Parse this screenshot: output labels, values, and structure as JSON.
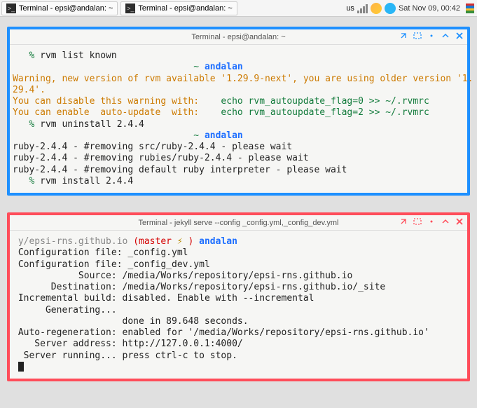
{
  "panel": {
    "task1": "Terminal - epsi@andalan: ~",
    "task2": "Terminal - epsi@andalan: ~",
    "kbd": "us",
    "clock": "Sat Nov 09, 00:42"
  },
  "win1": {
    "title": "Terminal - epsi@andalan: ~",
    "line1a": "% ",
    "line1b": "rvm list known",
    "ctx1a": "~ ",
    "ctx1b": "andalan",
    "warn1": "Warning, new version of rvm available '1.29.9-next', you are using older version '1.",
    "warn2": "29.4'.",
    "warn3a": "You can disable this warning with:    ",
    "warn3b": "echo rvm_autoupdate_flag=0 >> ~/.rvmrc",
    "warn4a": "You can enable  auto-update  with:    ",
    "warn4b": "echo rvm_autoupdate_flag=2 >> ~/.rvmrc",
    "line2a": "% ",
    "line2b": "rvm uninstall 2.4.4",
    "rem1": "ruby-2.4.4 - #removing src/ruby-2.4.4 - please wait",
    "rem2": "ruby-2.4.4 - #removing rubies/ruby-2.4.4 - please wait",
    "rem3": "ruby-2.4.4 - #removing default ruby interpreter - please wait",
    "line3a": "% ",
    "line3b": "rvm install 2.4.4"
  },
  "win2": {
    "title": "Terminal - jekyll serve --config _config.yml,_config_dev.yml",
    "path": "y/epsi-rns.github.io ",
    "branch": "(master ",
    "lightning": "⚡",
    "brclose": " ) ",
    "host": "andalan",
    "cfg1a": "Configuration file: ",
    "cfg1b": "_config.yml",
    "cfg2a": "Configuration file: ",
    "cfg2b": "_config_dev.yml",
    "src_a": "            Source: ",
    "src_b": "/media/Works/repository/epsi-rns.github.io",
    "dst_a": "       Destination: ",
    "dst_b": "/media/Works/repository/epsi-rns.github.io/_site",
    "inc_a": " Incremental build: ",
    "inc_b": "disabled. Enable with --incremental",
    "gen": "      Generating...",
    "done": "                    done in 89.648 seconds.",
    "ar_a": " Auto-regeneration: ",
    "ar_b": "enabled for '/media/Works/repository/epsi-rns.github.io'",
    "sa_a": "    Server address: ",
    "sa_b": "http://127.0.0.1:4000/",
    "sr_a": "  Server running... ",
    "sr_b": "press ctrl-c to stop."
  }
}
